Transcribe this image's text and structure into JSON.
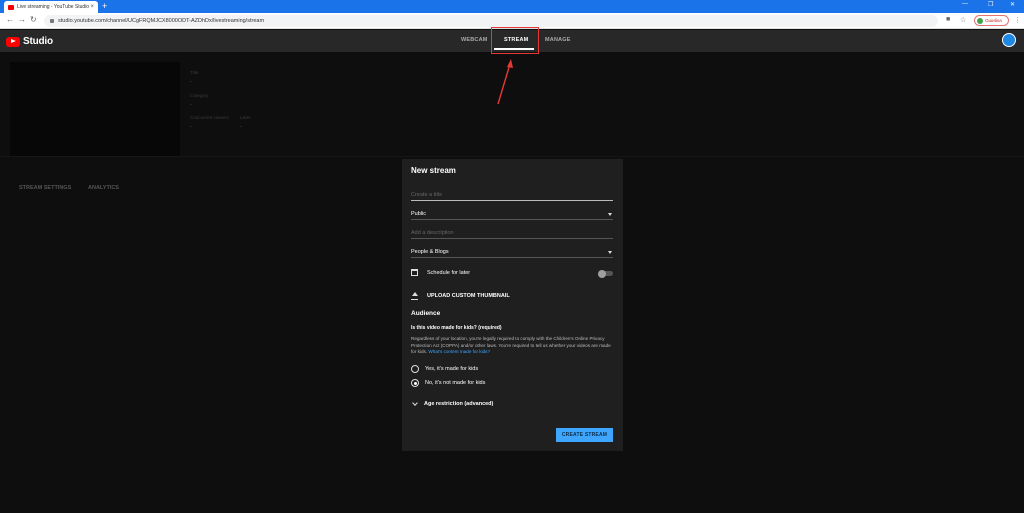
{
  "browser": {
    "tab_title": "Live streaming - YouTube Studio",
    "tab_close": "×",
    "new_tab": "+",
    "url": "studio.youtube.com/channel/UCgFRQMJCX8000ODT-AZDhDx/livestreaming/stream",
    "profile_label": "Ошибка"
  },
  "studio": {
    "logo_text": "Studio",
    "tabs": [
      {
        "label": "WEBCAM"
      },
      {
        "label": "STREAM"
      },
      {
        "label": "MANAGE"
      }
    ]
  },
  "background": {
    "title_label": "Title",
    "title_value": "-",
    "category_label": "Category",
    "category_value": "-",
    "viewers_label": "Concurrent viewers",
    "viewers_value": "-",
    "likes_label": "Likes",
    "likes_value": "-",
    "tabs": [
      "STREAM SETTINGS",
      "ANALYTICS"
    ]
  },
  "dialog": {
    "title": "New stream",
    "title_placeholder": "Create a title",
    "visibility": "Public",
    "description_placeholder": "Add a description",
    "category": "People & Blogs",
    "schedule_label": "Schedule for later",
    "schedule_enabled": false,
    "thumbnail_label": "UPLOAD CUSTOM THUMBNAIL",
    "audience_heading": "Audience",
    "kids_question": "Is this video made for kids? (required)",
    "kids_description": "Regardless of your location, you're legally required to comply with the Children's Online Privacy Protection Act (COPPA) and/or other laws. You're required to tell us whether your videos are made for kids.",
    "kids_link": "What's content made for kids?",
    "option_yes": "Yes, it's made for kids",
    "option_no": "No, it's not made for kids",
    "age_restriction": "Age restriction (advanced)",
    "create_button": "CREATE STREAM"
  },
  "colors": {
    "accent": "#3ea6ff",
    "highlight": "#e53935",
    "browser_blue": "#1a73e8"
  }
}
